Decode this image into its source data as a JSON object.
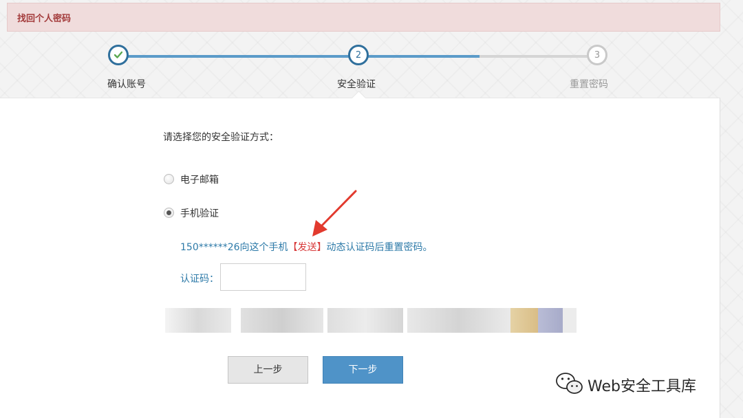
{
  "page": {
    "title": "找回个人密码"
  },
  "steps": [
    {
      "number": "1",
      "label": "确认账号",
      "state": "done"
    },
    {
      "number": "2",
      "label": "安全验证",
      "state": "current"
    },
    {
      "number": "3",
      "label": "重置密码",
      "state": "pending"
    }
  ],
  "form": {
    "prompt": "请选择您的安全验证方式：",
    "options": [
      {
        "label": "电子邮箱",
        "selected": false
      },
      {
        "label": "手机验证",
        "selected": true
      }
    ],
    "send_line": {
      "prefix": "150******26向这个手机",
      "link": "【发送】",
      "suffix": "动态认证码后重置密码。"
    },
    "code_label": "认证码：",
    "code_value": "",
    "buttons": {
      "prev": "上一步",
      "next": "下一步"
    }
  },
  "watermark": {
    "text": "Web安全工具库",
    "icon": "wechat-icon"
  },
  "colors": {
    "title_bg": "#f0dcdc",
    "title_text": "#a33b3b",
    "accent": "#2f6f9c",
    "link_red": "#d83a3a",
    "next_button": "#4f93c8"
  }
}
